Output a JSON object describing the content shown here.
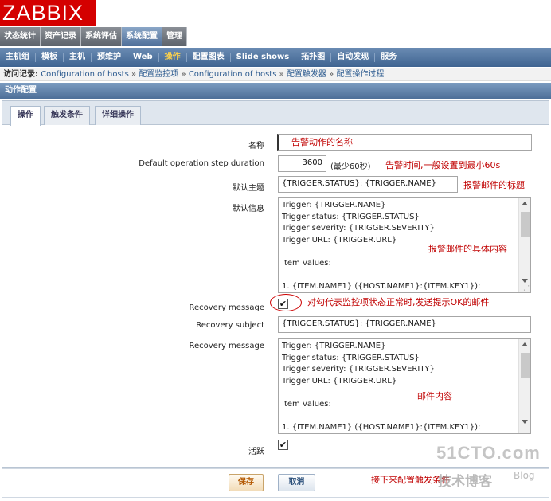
{
  "logo": {
    "text": "ZABBIX"
  },
  "main_menu": [
    {
      "label": "状态统计",
      "active": false
    },
    {
      "label": "资产记录",
      "active": false
    },
    {
      "label": "系统评估",
      "active": false
    },
    {
      "label": "系统配置",
      "active": true
    },
    {
      "label": "管理",
      "active": false
    }
  ],
  "sub_menu": [
    {
      "label": "主机组",
      "active": false
    },
    {
      "label": "模板",
      "active": false
    },
    {
      "label": "主机",
      "active": false
    },
    {
      "label": "预维护",
      "active": false
    },
    {
      "label": "Web",
      "active": false
    },
    {
      "label": "操作",
      "active": true
    },
    {
      "label": "配置图表",
      "active": false
    },
    {
      "label": "Slide shows",
      "active": false
    },
    {
      "label": "拓扑图",
      "active": false
    },
    {
      "label": "自动发现",
      "active": false
    },
    {
      "label": "服务",
      "active": false
    }
  ],
  "history": {
    "label": "访问记录:",
    "crumbs": [
      "Configuration of hosts",
      "配置监控项",
      "Configuration of hosts",
      "配置触发器",
      "配置操作过程"
    ],
    "separator": "»"
  },
  "section_title": "动作配置",
  "tabs": [
    {
      "label": "操作",
      "active": true
    },
    {
      "label": "触发条件",
      "active": false
    },
    {
      "label": "详细操作",
      "active": false
    }
  ],
  "form": {
    "name_label": "名称",
    "name_value": "",
    "step_label": "Default operation step duration",
    "step_value": "3600",
    "step_hint": "(最少60秒)",
    "subject_label": "默认主题",
    "subject_value": "{TRIGGER.STATUS}: {TRIGGER.NAME}",
    "message_label": "默认信息",
    "message_lines": [
      "Trigger: {TRIGGER.NAME}",
      "Trigger status: {TRIGGER.STATUS}",
      "Trigger severity: {TRIGGER.SEVERITY}",
      "Trigger URL: {TRIGGER.URL}",
      "",
      "Item values:",
      "",
      "1. {ITEM.NAME1} ({HOST.NAME1}:{ITEM.KEY1}):"
    ],
    "recovery_checkbox_label": "Recovery message",
    "recovery_checked": true,
    "recovery_subject_label": "Recovery subject",
    "recovery_subject_value": "{TRIGGER.STATUS}: {TRIGGER.NAME}",
    "recovery_message_label": "Recovery message",
    "recovery_message_lines": [
      "Trigger: {TRIGGER.NAME}",
      "Trigger status: {TRIGGER.STATUS}",
      "Trigger severity: {TRIGGER.SEVERITY}",
      "Trigger URL: {TRIGGER.URL}",
      "",
      "Item values:",
      "",
      "1. {ITEM.NAME1} ({HOST.NAME1}:{ITEM.KEY1}):"
    ],
    "active_label": "活跃",
    "active_checked": true,
    "check_glyph": "✔"
  },
  "buttons": {
    "save": "保存",
    "cancel": "取消"
  },
  "annotations": {
    "name_note": "告警动作的名称",
    "step_note": "告警时间,一般设置到最小60s",
    "subject_note": "报警邮件的标题",
    "message_note": "报警邮件的具体内容",
    "recovery_note": "对勾代表监控项状态正常时,发送提示OK的邮件",
    "recovery_message_note": "邮件内容",
    "footer_note": "接下来配置触发条件"
  },
  "watermark": {
    "site": "51CTO.com",
    "sub": "技术博客",
    "blog": "Blog"
  },
  "colors": {
    "annotation": "#c00000",
    "logo_bg": "#d40000",
    "active_submenu": "#ffd34a"
  }
}
